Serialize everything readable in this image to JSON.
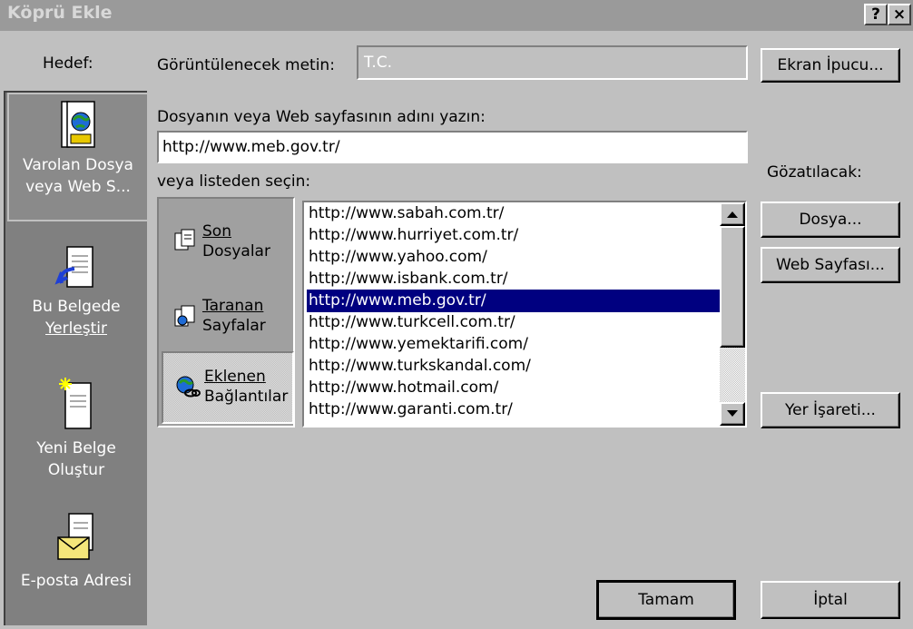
{
  "window": {
    "title": "Köprü Ekle",
    "help_button": "?",
    "close_button": "×"
  },
  "target_label": "Hedef:",
  "left_nav": [
    {
      "line1": "Varolan Dosya",
      "line2": "veya Web S...",
      "icon": "existing-file-icon",
      "selected": true
    },
    {
      "line1": "Bu Belgede",
      "line2": "Yerleştir",
      "icon": "place-in-document-icon",
      "selected": false
    },
    {
      "line1": "Yeni Belge",
      "line2": "Oluştur",
      "icon": "new-document-icon",
      "selected": false
    },
    {
      "line1": "E-posta Adresi",
      "line2": "",
      "icon": "email-icon",
      "selected": false
    }
  ],
  "display_text": {
    "label": "Görüntülenecek metin:",
    "value": "T.C."
  },
  "screen_tip_button": "Ekran İpucu...",
  "address": {
    "label": "Dosyanın veya Web sayfasının adını yazın:",
    "value": "http://www.meb.gov.tr/"
  },
  "or_select_label": "veya listeden seçin:",
  "browse_label": "Gözatılacak:",
  "sub_tabs": [
    {
      "line1": "Son",
      "line2": "Dosyalar",
      "icon": "recent-files-icon"
    },
    {
      "line1": "Taranan",
      "line2": "Sayfalar",
      "icon": "browsed-pages-icon"
    },
    {
      "line1": "Eklenen",
      "line2": "Bağlantılar",
      "icon": "inserted-links-icon"
    }
  ],
  "url_list": [
    "http://www.sabah.com.tr/",
    "http://www.hurriyet.com.tr/",
    "http://www.yahoo.com/",
    "http://www.isbank.com.tr/",
    "http://www.meb.gov.tr/",
    "http://www.turkcell.com.tr/",
    "http://www.yemektarifi.com/",
    "http://www.turkskandal.com/",
    "http://www.hotmail.com/",
    "http://www.garanti.com.tr/"
  ],
  "selected_url": "http://www.meb.gov.tr/",
  "file_button": "Dosya...",
  "web_page_button": "Web Sayfası...",
  "bookmark_button": "Yer İşareti...",
  "ok_button": "Tamam",
  "cancel_button": "İptal",
  "colors": {
    "selection": "#000080",
    "dialog": "#c0c0c0",
    "sidebar": "#808080"
  }
}
